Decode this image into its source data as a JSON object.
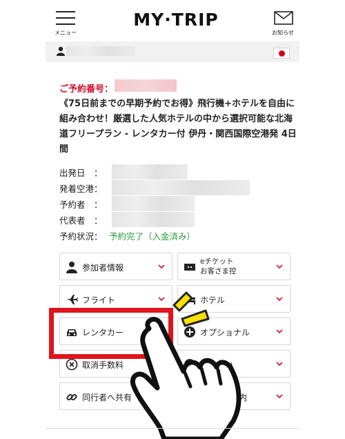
{
  "header": {
    "menu_label": "メニュー",
    "logo_text": "MY·TRIP",
    "notice_label": "お知らせ"
  },
  "reservation": {
    "number_label": "ご予約番号：",
    "plan_title": "《75日前までの早期予約でお得》飛行機+ホテルを自由に組み合わせ！厳選した人気ホテルの中から選択可能な北海道フリープラン - レンタカー付 伊丹・関西国際空港発 4日間",
    "fields": [
      {
        "label": "出発日　："
      },
      {
        "label": "発着空港："
      },
      {
        "label": "予約者　："
      },
      {
        "label": "代表者　："
      },
      {
        "label": "予約状況："
      }
    ],
    "status_value": "予約完了（入金済み）"
  },
  "buttons": [
    {
      "label": "参加者情報",
      "icon": "person-icon"
    },
    {
      "label": "eチケット\nお客さま控",
      "icon": "ticket-icon"
    },
    {
      "label": "フライト",
      "icon": "airplane-icon"
    },
    {
      "label": "ホテル",
      "icon": "bed-icon"
    },
    {
      "label": "レンタカー",
      "icon": "car-icon"
    },
    {
      "label": "オプショナル",
      "icon": "plus-circle-icon"
    },
    {
      "label": "取消手数料",
      "icon": "x-circle-icon"
    },
    {
      "label": "払い",
      "icon": "yen-icon"
    },
    {
      "label": "同行者へ共有",
      "icon": "link-icon"
    },
    {
      "label": "案内",
      "icon": "info-icon"
    }
  ],
  "colors": {
    "accent_red": "#d0112b",
    "status_green": "#2a9a3a",
    "highlight_red": "#e1141c",
    "hint_yellow": "#ffe100"
  }
}
